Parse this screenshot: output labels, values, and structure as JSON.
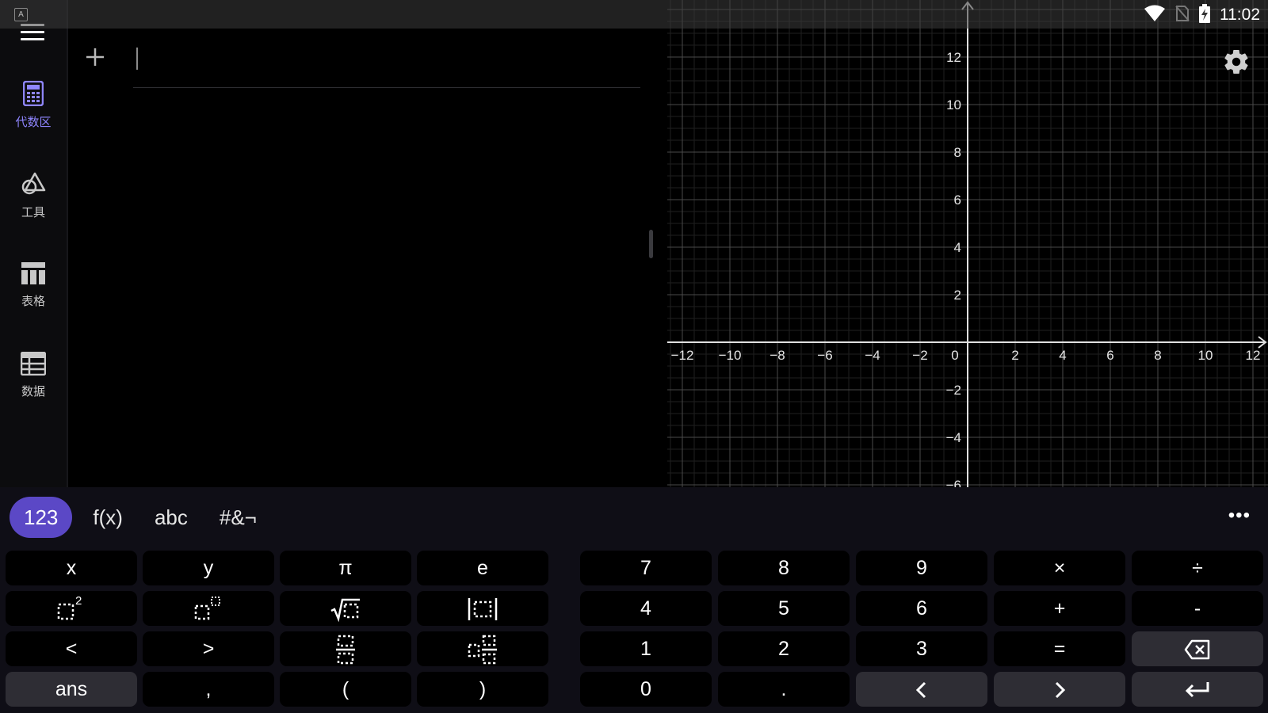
{
  "status_bar": {
    "app_icon_letter": "A",
    "time": "11:02"
  },
  "side_rail": {
    "items": [
      {
        "id": "algebra",
        "label": "代数区",
        "icon": "calculator-icon",
        "active": true
      },
      {
        "id": "tools",
        "label": "工具",
        "icon": "shapes-icon",
        "active": false
      },
      {
        "id": "table",
        "label": "表格",
        "icon": "table-icon",
        "active": false
      },
      {
        "id": "data",
        "label": "数据",
        "icon": "spreadsheet-icon",
        "active": false
      }
    ]
  },
  "algebra": {
    "input_value": ""
  },
  "graph": {
    "x_ticks": [
      "−12",
      "−10",
      "−8",
      "−6",
      "−4",
      "−2",
      "0",
      "2",
      "4",
      "6",
      "8",
      "10",
      "12"
    ],
    "y_ticks": [
      "12",
      "10",
      "8",
      "6",
      "4",
      "2",
      "−2",
      "−4",
      "−6"
    ],
    "xlim": [
      -12.6,
      12.6
    ],
    "ylim": [
      -6.4,
      14.3
    ],
    "grid": true
  },
  "keyboard": {
    "tabs": [
      {
        "label": "123",
        "active": true
      },
      {
        "label": "f(x)",
        "active": false
      },
      {
        "label": "abc",
        "active": false
      },
      {
        "label": "#&¬",
        "active": false
      }
    ],
    "more_label": "•••",
    "left_keys": [
      [
        "x",
        "y",
        "π",
        "e"
      ],
      [
        "square",
        "power",
        "sqrt",
        "abs"
      ],
      [
        "<",
        ">",
        "fraction",
        "subscript"
      ],
      [
        "ans",
        ",",
        "(",
        ")"
      ]
    ],
    "right_keys": [
      [
        "7",
        "8",
        "9",
        "×",
        "÷"
      ],
      [
        "4",
        "5",
        "6",
        "+",
        "-"
      ],
      [
        "1",
        "2",
        "3",
        "=",
        "backspace"
      ],
      [
        "0",
        ".",
        "left-arrow",
        "right-arrow",
        "enter"
      ]
    ],
    "squared_superscript": "2"
  },
  "colors": {
    "accent": "#5b48c6",
    "active_label": "#8f86ff",
    "keyboard_bg": "#0f0e16"
  }
}
